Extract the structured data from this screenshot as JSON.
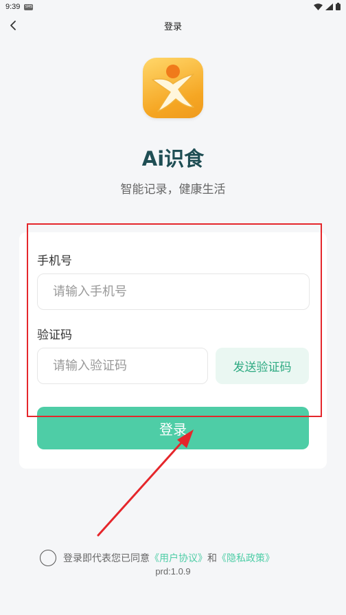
{
  "status_bar": {
    "time": "9:39",
    "sim_label": "SMS"
  },
  "nav": {
    "title": "登录"
  },
  "app": {
    "name": "Ai识食",
    "slogan": "智能记录，健康生活"
  },
  "form": {
    "phone_label": "手机号",
    "phone_placeholder": "请输入手机号",
    "phone_value": "",
    "code_label": "验证码",
    "code_placeholder": "请输入验证码",
    "code_value": "",
    "send_code_label": "发送验证码",
    "login_label": "登录"
  },
  "agreement": {
    "prefix": "登录即代表您已同意",
    "user_agreement": "《用户协议》",
    "conjunction": "和",
    "privacy_policy": "《隐私政策》",
    "checked": false
  },
  "version": "prd:1.0.9",
  "colors": {
    "accent": "#4ecda6",
    "accent_light": "#eaf7f2",
    "annotation": "#e5262b",
    "title": "#1f4e54",
    "logo": "#f5a623"
  }
}
